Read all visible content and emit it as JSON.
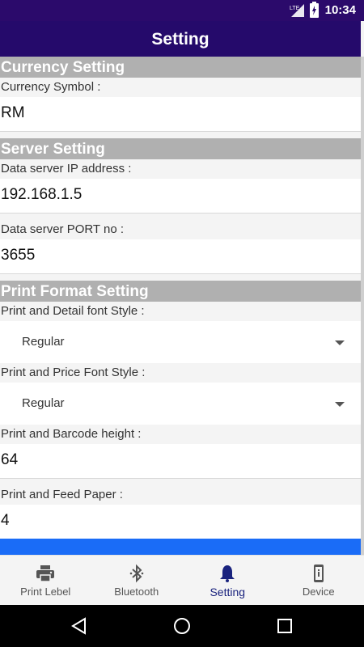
{
  "status": {
    "time": "10:34",
    "network": "LTE"
  },
  "app_bar": {
    "title": "Setting"
  },
  "sections": {
    "currency": {
      "header": "Currency Setting",
      "symbol_label": "Currency Symbol :",
      "symbol_value": "RM"
    },
    "server": {
      "header": "Server Setting",
      "ip_label": "Data server IP address :",
      "ip_value": "192.168.1.5",
      "port_label": "Data server PORT no :",
      "port_value": "3655"
    },
    "print": {
      "header": "Print Format Setting",
      "detail_font_label": "Print and Detail font Style :",
      "detail_font_value": "Regular",
      "price_font_label": "Print and Price Font Style :",
      "price_font_value": "Regular",
      "barcode_label": "Print and Barcode height :",
      "barcode_value": "64",
      "feed_label": "Print and Feed Paper :",
      "feed_value": "4"
    }
  },
  "bottom_nav": {
    "items": [
      {
        "label": "Print Lebel",
        "icon": "printer-icon"
      },
      {
        "label": "Bluetooth",
        "icon": "bluetooth-icon"
      },
      {
        "label": "Setting",
        "icon": "bell-icon",
        "active": true
      },
      {
        "label": "Device",
        "icon": "device-icon"
      }
    ]
  },
  "colors": {
    "app_bar": "#250a6b",
    "section_header": "#b0b0b0",
    "accent_bar": "#1a6cf7",
    "active_nav": "#1a237e"
  }
}
